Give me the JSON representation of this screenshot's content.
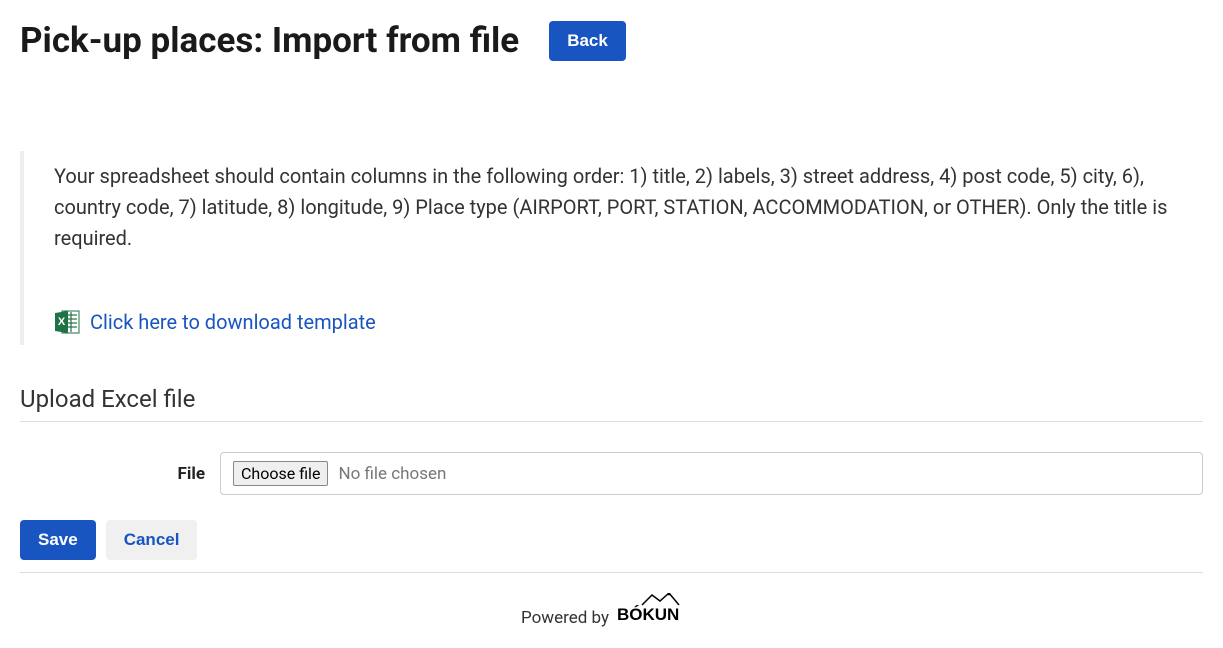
{
  "header": {
    "title": "Pick-up places: Import from file",
    "back_label": "Back"
  },
  "info": {
    "description": "Your spreadsheet should contain columns in the following order: 1) title, 2) labels, 3) street address, 4) post code, 5) city, 6), country code, 7) latitude, 8) longitude, 9) Place type (AIRPORT, PORT, STATION, ACCOMMODATION, or OTHER). Only the title is required.",
    "download_link_text": "Click here to download template"
  },
  "upload": {
    "section_title": "Upload Excel file",
    "file_label": "File",
    "choose_file_label": "Choose file",
    "no_file_text": "No file chosen"
  },
  "actions": {
    "save_label": "Save",
    "cancel_label": "Cancel"
  },
  "footer": {
    "powered_by": "Powered by",
    "brand": "BÓKUN"
  }
}
